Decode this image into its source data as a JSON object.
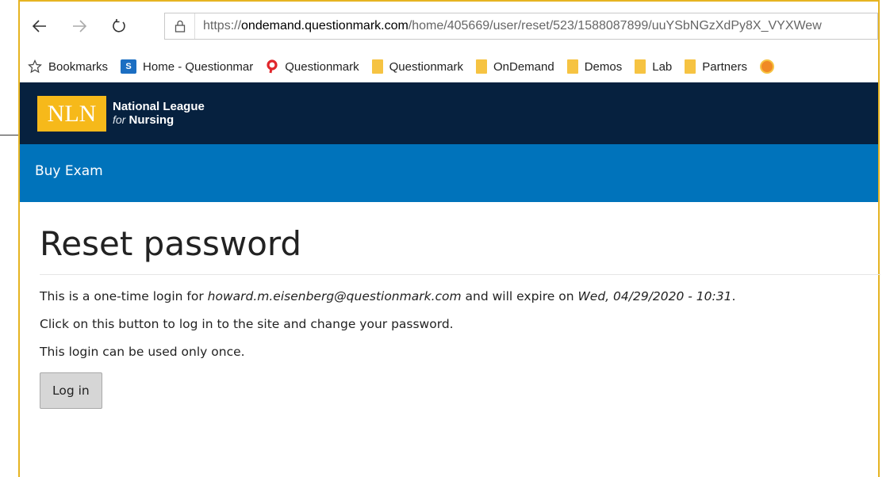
{
  "browser": {
    "url_scheme": "https://",
    "url_host": "ondemand.questionmark.com",
    "url_path": "/home/405669/user/reset/523/1588087899/uuYSbNGzXdPy8X_VYXWew",
    "icons": {
      "back": "arrow-left-icon",
      "forward": "arrow-right-icon",
      "refresh": "refresh-icon",
      "lock": "lock-icon"
    }
  },
  "bookmarks": [
    {
      "label": "Bookmarks",
      "icon": "star-icon"
    },
    {
      "label": "Home - Questionmar",
      "icon": "sharepoint-icon"
    },
    {
      "label": "Questionmark",
      "icon": "questionmark-logo-icon"
    },
    {
      "label": "Questionmark",
      "icon": "folder-icon"
    },
    {
      "label": "OnDemand",
      "icon": "folder-icon"
    },
    {
      "label": "Demos",
      "icon": "folder-icon"
    },
    {
      "label": "Lab",
      "icon": "folder-icon"
    },
    {
      "label": "Partners",
      "icon": "folder-icon"
    }
  ],
  "site": {
    "logo_mark": "NLN",
    "logo_line1": "National League",
    "logo_line2_prefix": "for",
    "logo_line2_main": "Nursing",
    "nav_item": "Buy Exam",
    "colors": {
      "header_bg": "#06213f",
      "nav_bg": "#0073bb",
      "logo_bg": "#f6b91a"
    }
  },
  "page": {
    "title": "Reset password",
    "line1_prefix": "This is a one-time login for ",
    "line1_email": "howard.m.eisenberg@questionmark.com",
    "line1_middle": " and will expire on ",
    "line1_date": "Wed, 04/29/2020 - 10:31",
    "line1_suffix": ".",
    "line2": "Click on this button to log in to the site and change your password.",
    "line3": "This login can be used only once.",
    "login_button": "Log in"
  }
}
